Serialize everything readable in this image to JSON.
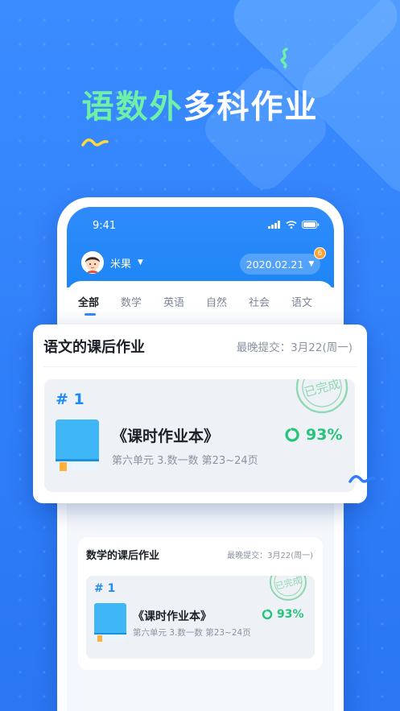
{
  "hero": {
    "highlight": "语数外",
    "rest": "多科作业"
  },
  "phone": {
    "status_time": "9:41",
    "user": {
      "name": "米果"
    },
    "date": "2020.02.21",
    "date_badge": "6",
    "tabs": [
      "全部",
      "数学",
      "英语",
      "自然",
      "社会",
      "语文"
    ],
    "active_tab": 0
  },
  "featured_card": {
    "title": "语文的课后作业",
    "due": "最晚提交：3月22(周一)",
    "number": "# 1",
    "homework_name": "《课时作业本》",
    "detail": "第六单元 3.数一数 第23~24页",
    "progress": "93%",
    "stamp": "已完成"
  },
  "second_card": {
    "title": "数学的课后作业",
    "due": "最晚提交：3月22(周一)",
    "number": "# 1",
    "homework_name": "《课时作业本》",
    "detail": "第六单元 3.数一数 第23~24页",
    "progress": "93%",
    "stamp": "已完成"
  },
  "colors": {
    "brand_blue": "#2f8bfb",
    "done_green": "#26c47a",
    "badge_orange": "#ffa230",
    "hero_green": "#6ef0a6"
  }
}
